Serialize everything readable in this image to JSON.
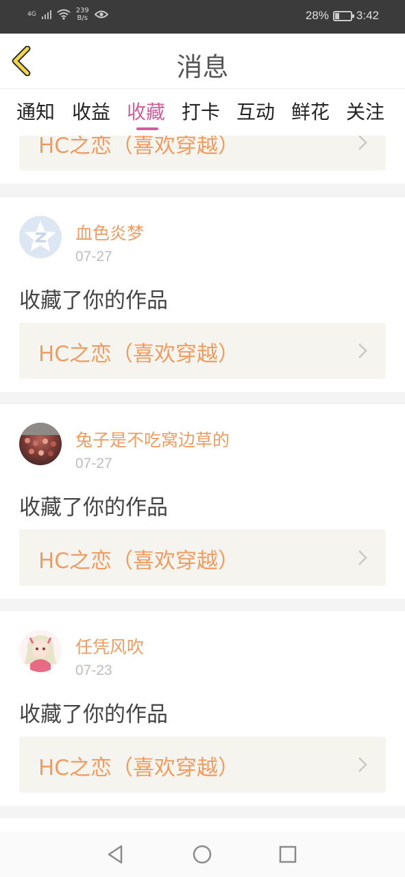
{
  "status_bar": {
    "signal_label": "4G",
    "speed_value": "239",
    "speed_unit": "B/s",
    "battery": "28%",
    "battery_level": 0.28,
    "time": "3:42",
    "icons": [
      "signal-icon",
      "wifi-icon",
      "eye-icon",
      "battery-icon"
    ]
  },
  "header": {
    "title": "消息",
    "back_icon": "chevron-left-icon"
  },
  "tabs": [
    {
      "label": "通知",
      "active": false
    },
    {
      "label": "收益",
      "active": false
    },
    {
      "label": "收藏",
      "active": true
    },
    {
      "label": "打卡",
      "active": false
    },
    {
      "label": "互动",
      "active": false
    },
    {
      "label": "鲜花",
      "active": false
    },
    {
      "label": "关注",
      "active": false
    }
  ],
  "feed": {
    "partial_card": {
      "work_title": "HC之恋（喜欢穿越）"
    },
    "items": [
      {
        "username": "血色炎梦",
        "date": "07-27",
        "action": "收藏了你的作品",
        "work_title": "HC之恋（喜欢穿越）",
        "avatar": "default-star-avatar"
      },
      {
        "username": "兔子是不吃窝边草的",
        "date": "07-27",
        "action": "收藏了你的作品",
        "work_title": "HC之恋（喜欢穿越）",
        "avatar": "crowd-photo-avatar"
      },
      {
        "username": "任凭风吹",
        "date": "07-23",
        "action": "收藏了你的作品",
        "work_title": "HC之恋（喜欢穿越）",
        "avatar": "anime-girl-avatar"
      }
    ]
  },
  "nav_bar": {
    "buttons": [
      "back-triangle-icon",
      "home-circle-icon",
      "recents-square-icon"
    ]
  },
  "colors": {
    "accent_pink": "#d15e9c",
    "orange_text": "#ef9c62",
    "link_bg": "#f5f4ee",
    "back_chevron": "#f2d54c"
  }
}
